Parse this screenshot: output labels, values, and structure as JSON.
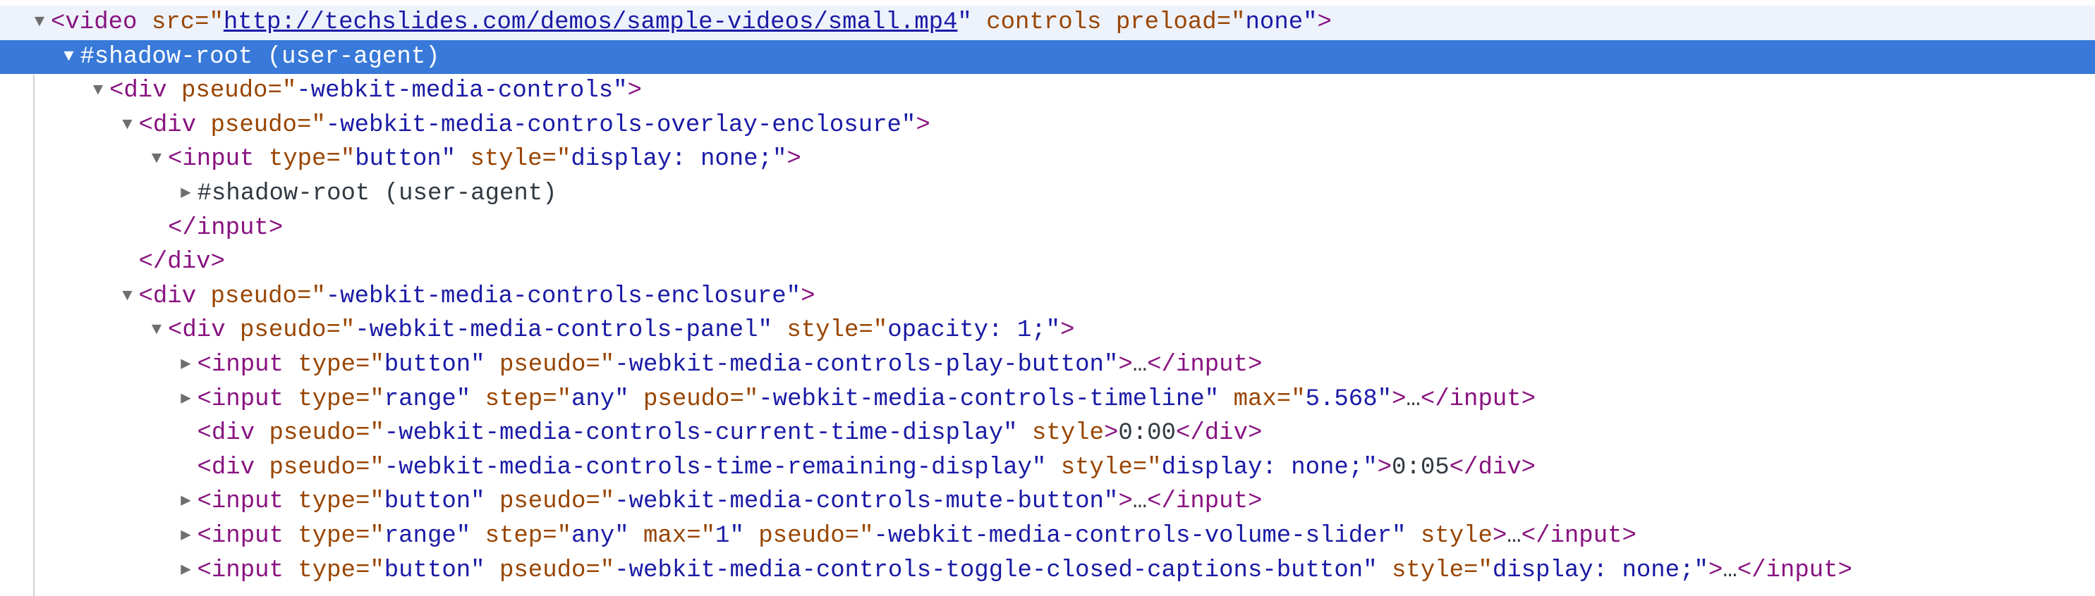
{
  "colors": {
    "selected_bg": "#3879d9",
    "tag": "#881280",
    "attr": "#994500",
    "value": "#1a1aa6"
  },
  "lines": [
    {
      "level": 0,
      "toggle": "expanded",
      "state": "hover",
      "tokens": [
        [
          "tag",
          "<video"
        ],
        [
          "attr",
          " src=\""
        ],
        [
          "link",
          "http://techslides.com/demos/sample-videos/small.mp4"
        ],
        [
          "val",
          "\""
        ],
        [
          "attr",
          " controls"
        ],
        [
          "attr",
          " preload=\""
        ],
        [
          "val",
          "none\""
        ],
        [
          "tag",
          ">"
        ]
      ]
    },
    {
      "level": 1,
      "toggle": "expanded",
      "state": "selected",
      "tokens": [
        [
          "text",
          "#shadow-root (user-agent)"
        ]
      ]
    },
    {
      "level": 2,
      "toggle": "expanded",
      "tokens": [
        [
          "tag",
          "<div"
        ],
        [
          "attr",
          " pseudo=\""
        ],
        [
          "val",
          "-webkit-media-controls\""
        ],
        [
          "tag",
          ">"
        ]
      ]
    },
    {
      "level": 3,
      "toggle": "expanded",
      "tokens": [
        [
          "tag",
          "<div"
        ],
        [
          "attr",
          " pseudo=\""
        ],
        [
          "val",
          "-webkit-media-controls-overlay-enclosure\""
        ],
        [
          "tag",
          ">"
        ]
      ]
    },
    {
      "level": 4,
      "toggle": "expanded",
      "tokens": [
        [
          "tag",
          "<input"
        ],
        [
          "attr",
          " type=\""
        ],
        [
          "val",
          "button\""
        ],
        [
          "attr",
          " style=\""
        ],
        [
          "val",
          "display: none;\""
        ],
        [
          "tag",
          ">"
        ]
      ]
    },
    {
      "level": 5,
      "toggle": "collapsed",
      "tokens": [
        [
          "text",
          "#shadow-root (user-agent)"
        ]
      ]
    },
    {
      "level": 4,
      "toggle": "none",
      "tokens": [
        [
          "tag",
          "</input>"
        ]
      ]
    },
    {
      "level": 3,
      "toggle": "none",
      "tokens": [
        [
          "tag",
          "</div>"
        ]
      ]
    },
    {
      "level": 3,
      "toggle": "expanded",
      "tokens": [
        [
          "tag",
          "<div"
        ],
        [
          "attr",
          " pseudo=\""
        ],
        [
          "val",
          "-webkit-media-controls-enclosure\""
        ],
        [
          "tag",
          ">"
        ]
      ]
    },
    {
      "level": 4,
      "toggle": "expanded",
      "tokens": [
        [
          "tag",
          "<div"
        ],
        [
          "attr",
          " pseudo=\""
        ],
        [
          "val",
          "-webkit-media-controls-panel\""
        ],
        [
          "attr",
          " style=\""
        ],
        [
          "val",
          "opacity: 1;\""
        ],
        [
          "tag",
          ">"
        ]
      ]
    },
    {
      "level": 5,
      "toggle": "collapsed",
      "tokens": [
        [
          "tag",
          "<input"
        ],
        [
          "attr",
          " type=\""
        ],
        [
          "val",
          "button\""
        ],
        [
          "attr",
          " pseudo=\""
        ],
        [
          "val",
          "-webkit-media-controls-play-button\""
        ],
        [
          "tag",
          ">"
        ],
        [
          "text",
          "…"
        ],
        [
          "tag",
          "</input>"
        ]
      ]
    },
    {
      "level": 5,
      "toggle": "collapsed",
      "tokens": [
        [
          "tag",
          "<input"
        ],
        [
          "attr",
          " type=\""
        ],
        [
          "val",
          "range\""
        ],
        [
          "attr",
          " step=\""
        ],
        [
          "val",
          "any\""
        ],
        [
          "attr",
          " pseudo=\""
        ],
        [
          "val",
          "-webkit-media-controls-timeline\""
        ],
        [
          "attr",
          " max=\""
        ],
        [
          "val",
          "5.568\""
        ],
        [
          "tag",
          ">"
        ],
        [
          "text",
          "…"
        ],
        [
          "tag",
          "</input>"
        ]
      ]
    },
    {
      "level": 5,
      "toggle": "none",
      "tokens": [
        [
          "tag",
          "<div"
        ],
        [
          "attr",
          " pseudo=\""
        ],
        [
          "val",
          "-webkit-media-controls-current-time-display\""
        ],
        [
          "attr",
          " style"
        ],
        [
          "tag",
          ">"
        ],
        [
          "text",
          "0:00"
        ],
        [
          "tag",
          "</div>"
        ]
      ]
    },
    {
      "level": 5,
      "toggle": "none",
      "tokens": [
        [
          "tag",
          "<div"
        ],
        [
          "attr",
          " pseudo=\""
        ],
        [
          "val",
          "-webkit-media-controls-time-remaining-display\""
        ],
        [
          "attr",
          " style=\""
        ],
        [
          "val",
          "display: none;\""
        ],
        [
          "tag",
          ">"
        ],
        [
          "text",
          "0:05"
        ],
        [
          "tag",
          "</div>"
        ]
      ]
    },
    {
      "level": 5,
      "toggle": "collapsed",
      "tokens": [
        [
          "tag",
          "<input"
        ],
        [
          "attr",
          " type=\""
        ],
        [
          "val",
          "button\""
        ],
        [
          "attr",
          " pseudo=\""
        ],
        [
          "val",
          "-webkit-media-controls-mute-button\""
        ],
        [
          "tag",
          ">"
        ],
        [
          "text",
          "…"
        ],
        [
          "tag",
          "</input>"
        ]
      ]
    },
    {
      "level": 5,
      "toggle": "collapsed",
      "tokens": [
        [
          "tag",
          "<input"
        ],
        [
          "attr",
          " type=\""
        ],
        [
          "val",
          "range\""
        ],
        [
          "attr",
          " step=\""
        ],
        [
          "val",
          "any\""
        ],
        [
          "attr",
          " max=\""
        ],
        [
          "val",
          "1\""
        ],
        [
          "attr",
          " pseudo=\""
        ],
        [
          "val",
          "-webkit-media-controls-volume-slider\""
        ],
        [
          "attr",
          " style"
        ],
        [
          "tag",
          ">"
        ],
        [
          "text",
          "…"
        ],
        [
          "tag",
          "</input>"
        ]
      ]
    },
    {
      "level": 5,
      "toggle": "collapsed",
      "tokens": [
        [
          "tag",
          "<input"
        ],
        [
          "attr",
          " type=\""
        ],
        [
          "val",
          "button\""
        ],
        [
          "attr",
          " pseudo=\""
        ],
        [
          "val",
          "-webkit-media-controls-toggle-closed-captions-button\""
        ],
        [
          "attr",
          " style=\""
        ],
        [
          "val",
          "display: none;\""
        ],
        [
          "tag",
          ">"
        ],
        [
          "text",
          "…"
        ],
        [
          "tag",
          "</input>"
        ]
      ]
    }
  ]
}
